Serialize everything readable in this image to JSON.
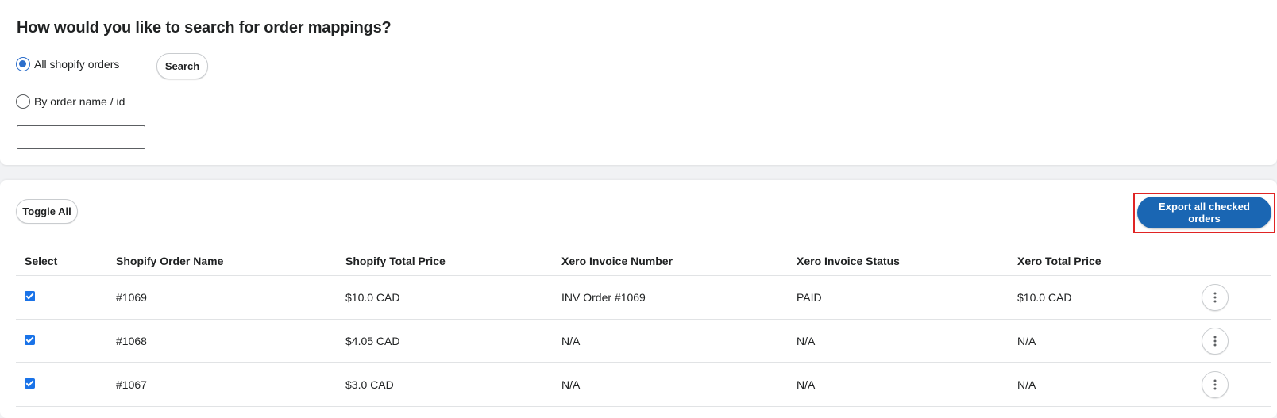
{
  "search_card": {
    "title": "How would you like to search for order mappings?",
    "options": [
      {
        "label": "All shopify orders",
        "selected": true
      },
      {
        "label": "By order name / id",
        "selected": false
      }
    ],
    "search_button": "Search",
    "order_input": {
      "value": "",
      "placeholder": ""
    }
  },
  "orders_card": {
    "toggle_button": "Toggle All",
    "export_button": "Export all checked orders",
    "columns": [
      "Select",
      "Shopify Order Name",
      "Shopify Total Price",
      "Xero Invoice Number",
      "Xero Invoice Status",
      "Xero Total Price"
    ],
    "rows": [
      {
        "checked": true,
        "order_name": "#1069",
        "shopify_price": "$10.0 CAD",
        "invoice_number": "INV Order #1069",
        "invoice_status": "PAID",
        "xero_price": "$10.0 CAD"
      },
      {
        "checked": true,
        "order_name": "#1068",
        "shopify_price": "$4.05 CAD",
        "invoice_number": "N/A",
        "invoice_status": "N/A",
        "xero_price": "N/A"
      },
      {
        "checked": true,
        "order_name": "#1067",
        "shopify_price": "$3.0 CAD",
        "invoice_number": "N/A",
        "invoice_status": "N/A",
        "xero_price": "N/A"
      }
    ]
  },
  "colors": {
    "primary_button": "#1a66b3",
    "radio_selected": "#2c6ecb",
    "highlight_outline": "#e02424",
    "checkbox": "#1a73e8"
  },
  "icons": {
    "row_action": "vertical-ellipsis-icon"
  }
}
